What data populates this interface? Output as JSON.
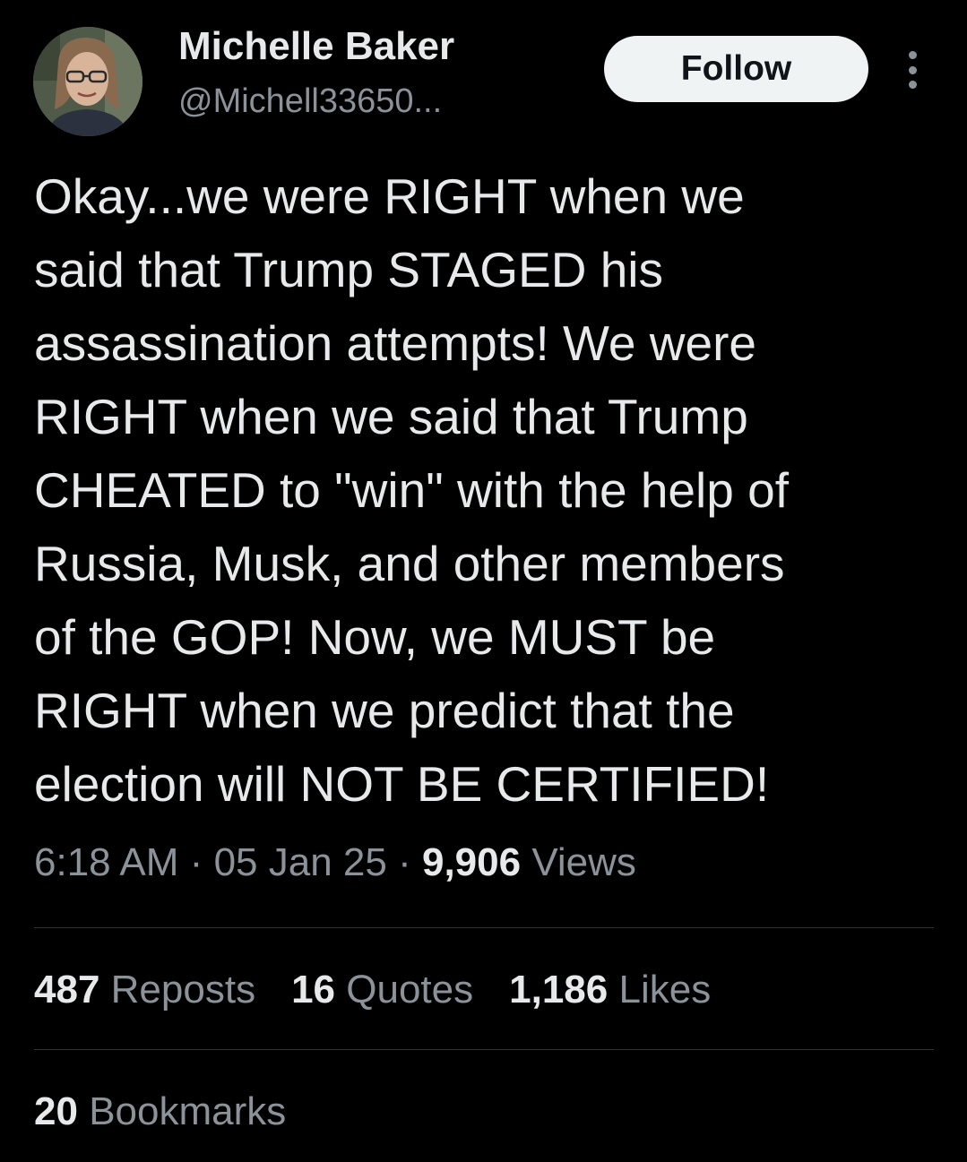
{
  "author": {
    "display_name": "Michelle Baker",
    "handle": "@Michell33650..."
  },
  "follow_label": "Follow",
  "tweet": {
    "text": "Okay...we were RIGHT when we\nsaid that Trump STAGED his\nassassination attempts!  We were\nRIGHT when we said that Trump\nCHEATED to \"win\" with the help of\nRussia, Musk, and other members\nof the GOP!  Now, we MUST be\nRIGHT when we predict that the\nelection will NOT BE CERTIFIED!",
    "time": "6:18 AM",
    "separator": "·",
    "date": "05 Jan 25",
    "views_count": "9,906",
    "views_label": "Views"
  },
  "stats": {
    "reposts": {
      "count": "487",
      "label": "Reposts"
    },
    "quotes": {
      "count": "16",
      "label": "Quotes"
    },
    "likes": {
      "count": "1,186",
      "label": "Likes"
    },
    "bookmarks": {
      "count": "20",
      "label": "Bookmarks"
    }
  },
  "icons": {
    "avatar": "avatar-photo",
    "more": "more-options-icon"
  },
  "colors": {
    "background": "#000000",
    "primary_text": "#e7e9ea",
    "secondary_text": "#8b9299",
    "divider": "#2f3336",
    "follow_button_bg": "#eff3f4"
  }
}
